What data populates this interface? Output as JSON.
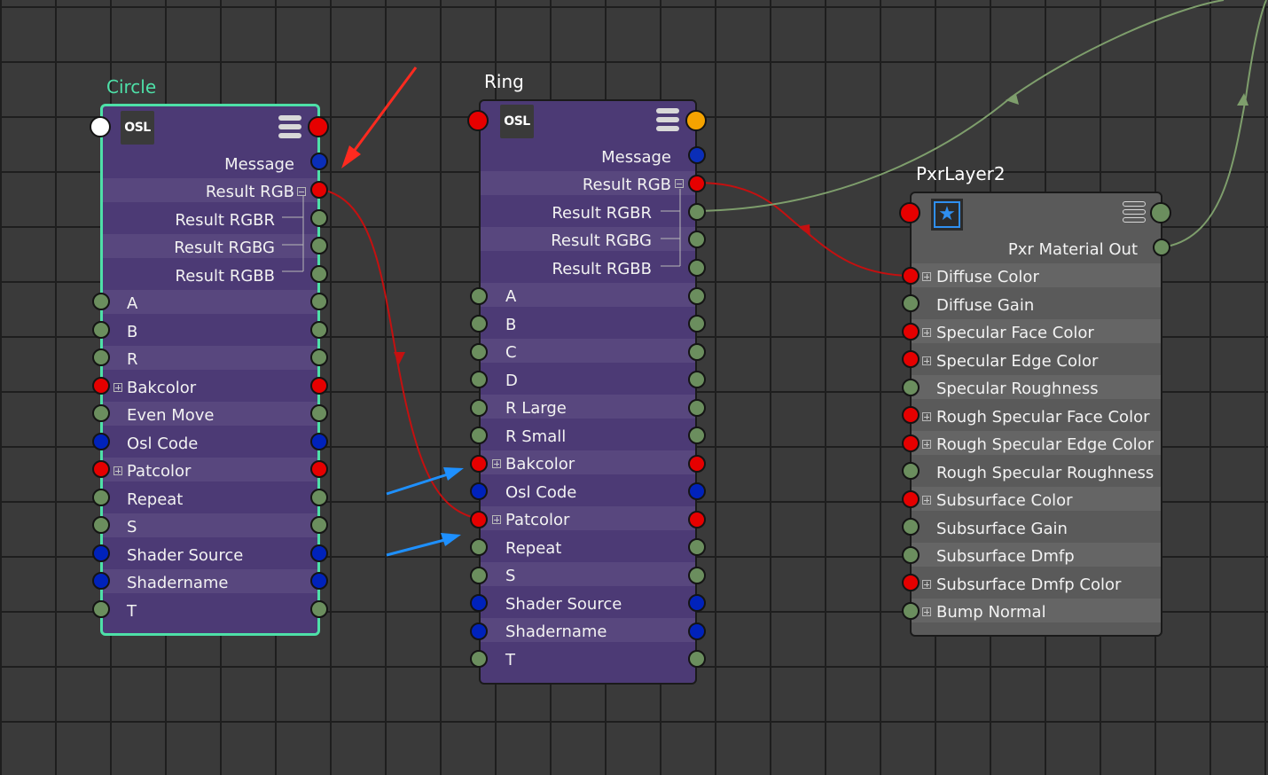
{
  "colors": {
    "float": "#6b8e5e",
    "color": "#e60000",
    "string": "#0022bb",
    "message": "#0a2eb8",
    "white": "#ffffff",
    "orange": "#f5a300",
    "selection": "#4ee0a8",
    "wire_red": "#c41010",
    "wire_green": "#7e9e6c",
    "annotation_red": "#ff2a1f",
    "annotation_blue": "#1e90ff"
  },
  "nodes": {
    "circle": {
      "title": "Circle",
      "icon": "osl-icon",
      "logo_text": "OSL",
      "outputs": [
        "Message",
        "Result RGB",
        "Result RGBR",
        "Result RGBG",
        "Result RGBB"
      ],
      "inputs": [
        "A",
        "B",
        "R",
        "Bakcolor",
        "Even Move",
        "Osl Code",
        "Patcolor",
        "Repeat",
        "S",
        "Shader Source",
        "Shadername",
        "T"
      ]
    },
    "ring": {
      "title": "Ring",
      "icon": "osl-icon",
      "logo_text": "OSL",
      "outputs": [
        "Message",
        "Result RGB",
        "Result RGBR",
        "Result RGBG",
        "Result RGBB"
      ],
      "inputs": [
        "A",
        "B",
        "C",
        "D",
        "R Large",
        "R Small",
        "Bakcolor",
        "Osl Code",
        "Patcolor",
        "Repeat",
        "S",
        "Shader Source",
        "Shadername",
        "T"
      ]
    },
    "pxrlayer2": {
      "title": "PxrLayer2",
      "icon": "star-icon",
      "icon_glyph": "★",
      "outputs": [
        "Pxr Material Out"
      ],
      "inputs": [
        "Diffuse Color",
        "Diffuse Gain",
        "Specular Face Color",
        "Specular Edge Color",
        "Specular Roughness",
        "Rough Specular Face Color",
        "Rough Specular Edge Color",
        "Rough Specular Roughness",
        "Subsurface Color",
        "Subsurface Gain",
        "Subsurface Dmfp",
        "Subsurface Dmfp Color",
        "Bump Normal"
      ]
    }
  },
  "connections": [
    {
      "from": "Circle.Result RGB",
      "to": "Ring.Patcolor"
    },
    {
      "from": "Ring.Result RGB",
      "to": "PxrLayer2.Diffuse Color"
    },
    {
      "from": "Ring.Result RGBR",
      "to": "(off-screen)"
    },
    {
      "from": "PxrLayer2.Pxr Material Out",
      "to": "(off-screen)"
    }
  ]
}
